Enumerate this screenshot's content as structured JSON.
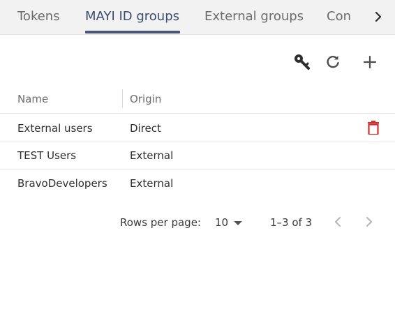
{
  "tabs": [
    {
      "label": "Tokens"
    },
    {
      "label": "MAYI ID groups"
    },
    {
      "label": "External groups"
    },
    {
      "label": "Con"
    }
  ],
  "active_tab": "MAYI ID groups",
  "toolbar": {
    "icons": [
      "key-icon",
      "refresh-icon",
      "add-icon"
    ]
  },
  "table": {
    "columns": [
      "Name",
      "Origin"
    ],
    "rows": [
      {
        "name": "External users",
        "origin": "Direct"
      },
      {
        "name": "TEST Users",
        "origin": "External"
      },
      {
        "name": "BravoDevelopers",
        "origin": "External"
      }
    ]
  },
  "pagination": {
    "rows_per_page_label": "Rows per page:",
    "rows_per_page_value": "10",
    "range_text": "1–3 of 3"
  },
  "colors": {
    "accent": "#4a5578",
    "delete": "#d32f2f"
  }
}
